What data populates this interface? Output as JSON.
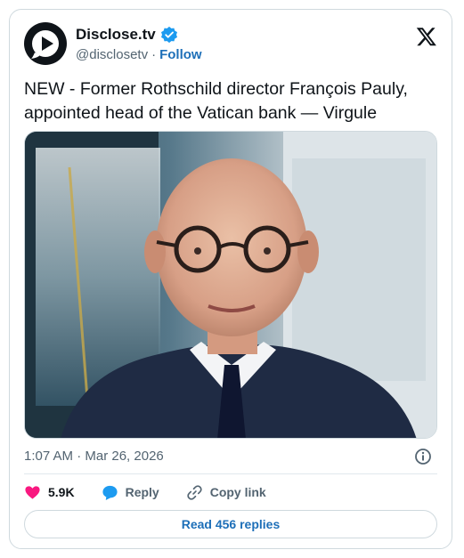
{
  "account": {
    "name": "Disclose.tv",
    "handle": "@disclosetv",
    "separator": "·",
    "follow_label": "Follow"
  },
  "tweet": {
    "text": "NEW - Former Rothschild director François Pauly, appointed head of the Vatican bank — Virgule",
    "timestamp": "1:07 AM · Mar 26, 2026"
  },
  "actions": {
    "like_count": "5.9K",
    "reply_label": "Reply",
    "copy_link_label": "Copy link",
    "read_replies_label": "Read 456 replies"
  },
  "colors": {
    "like": "#f91880",
    "reply": "#1d9bf0",
    "verified": "#1d9bf0",
    "link": "#1d6fb8"
  },
  "icons": [
    "play-logo-icon",
    "verified-badge-icon",
    "x-logo-icon",
    "info-icon",
    "heart-icon",
    "reply-bubble-icon",
    "link-icon"
  ]
}
